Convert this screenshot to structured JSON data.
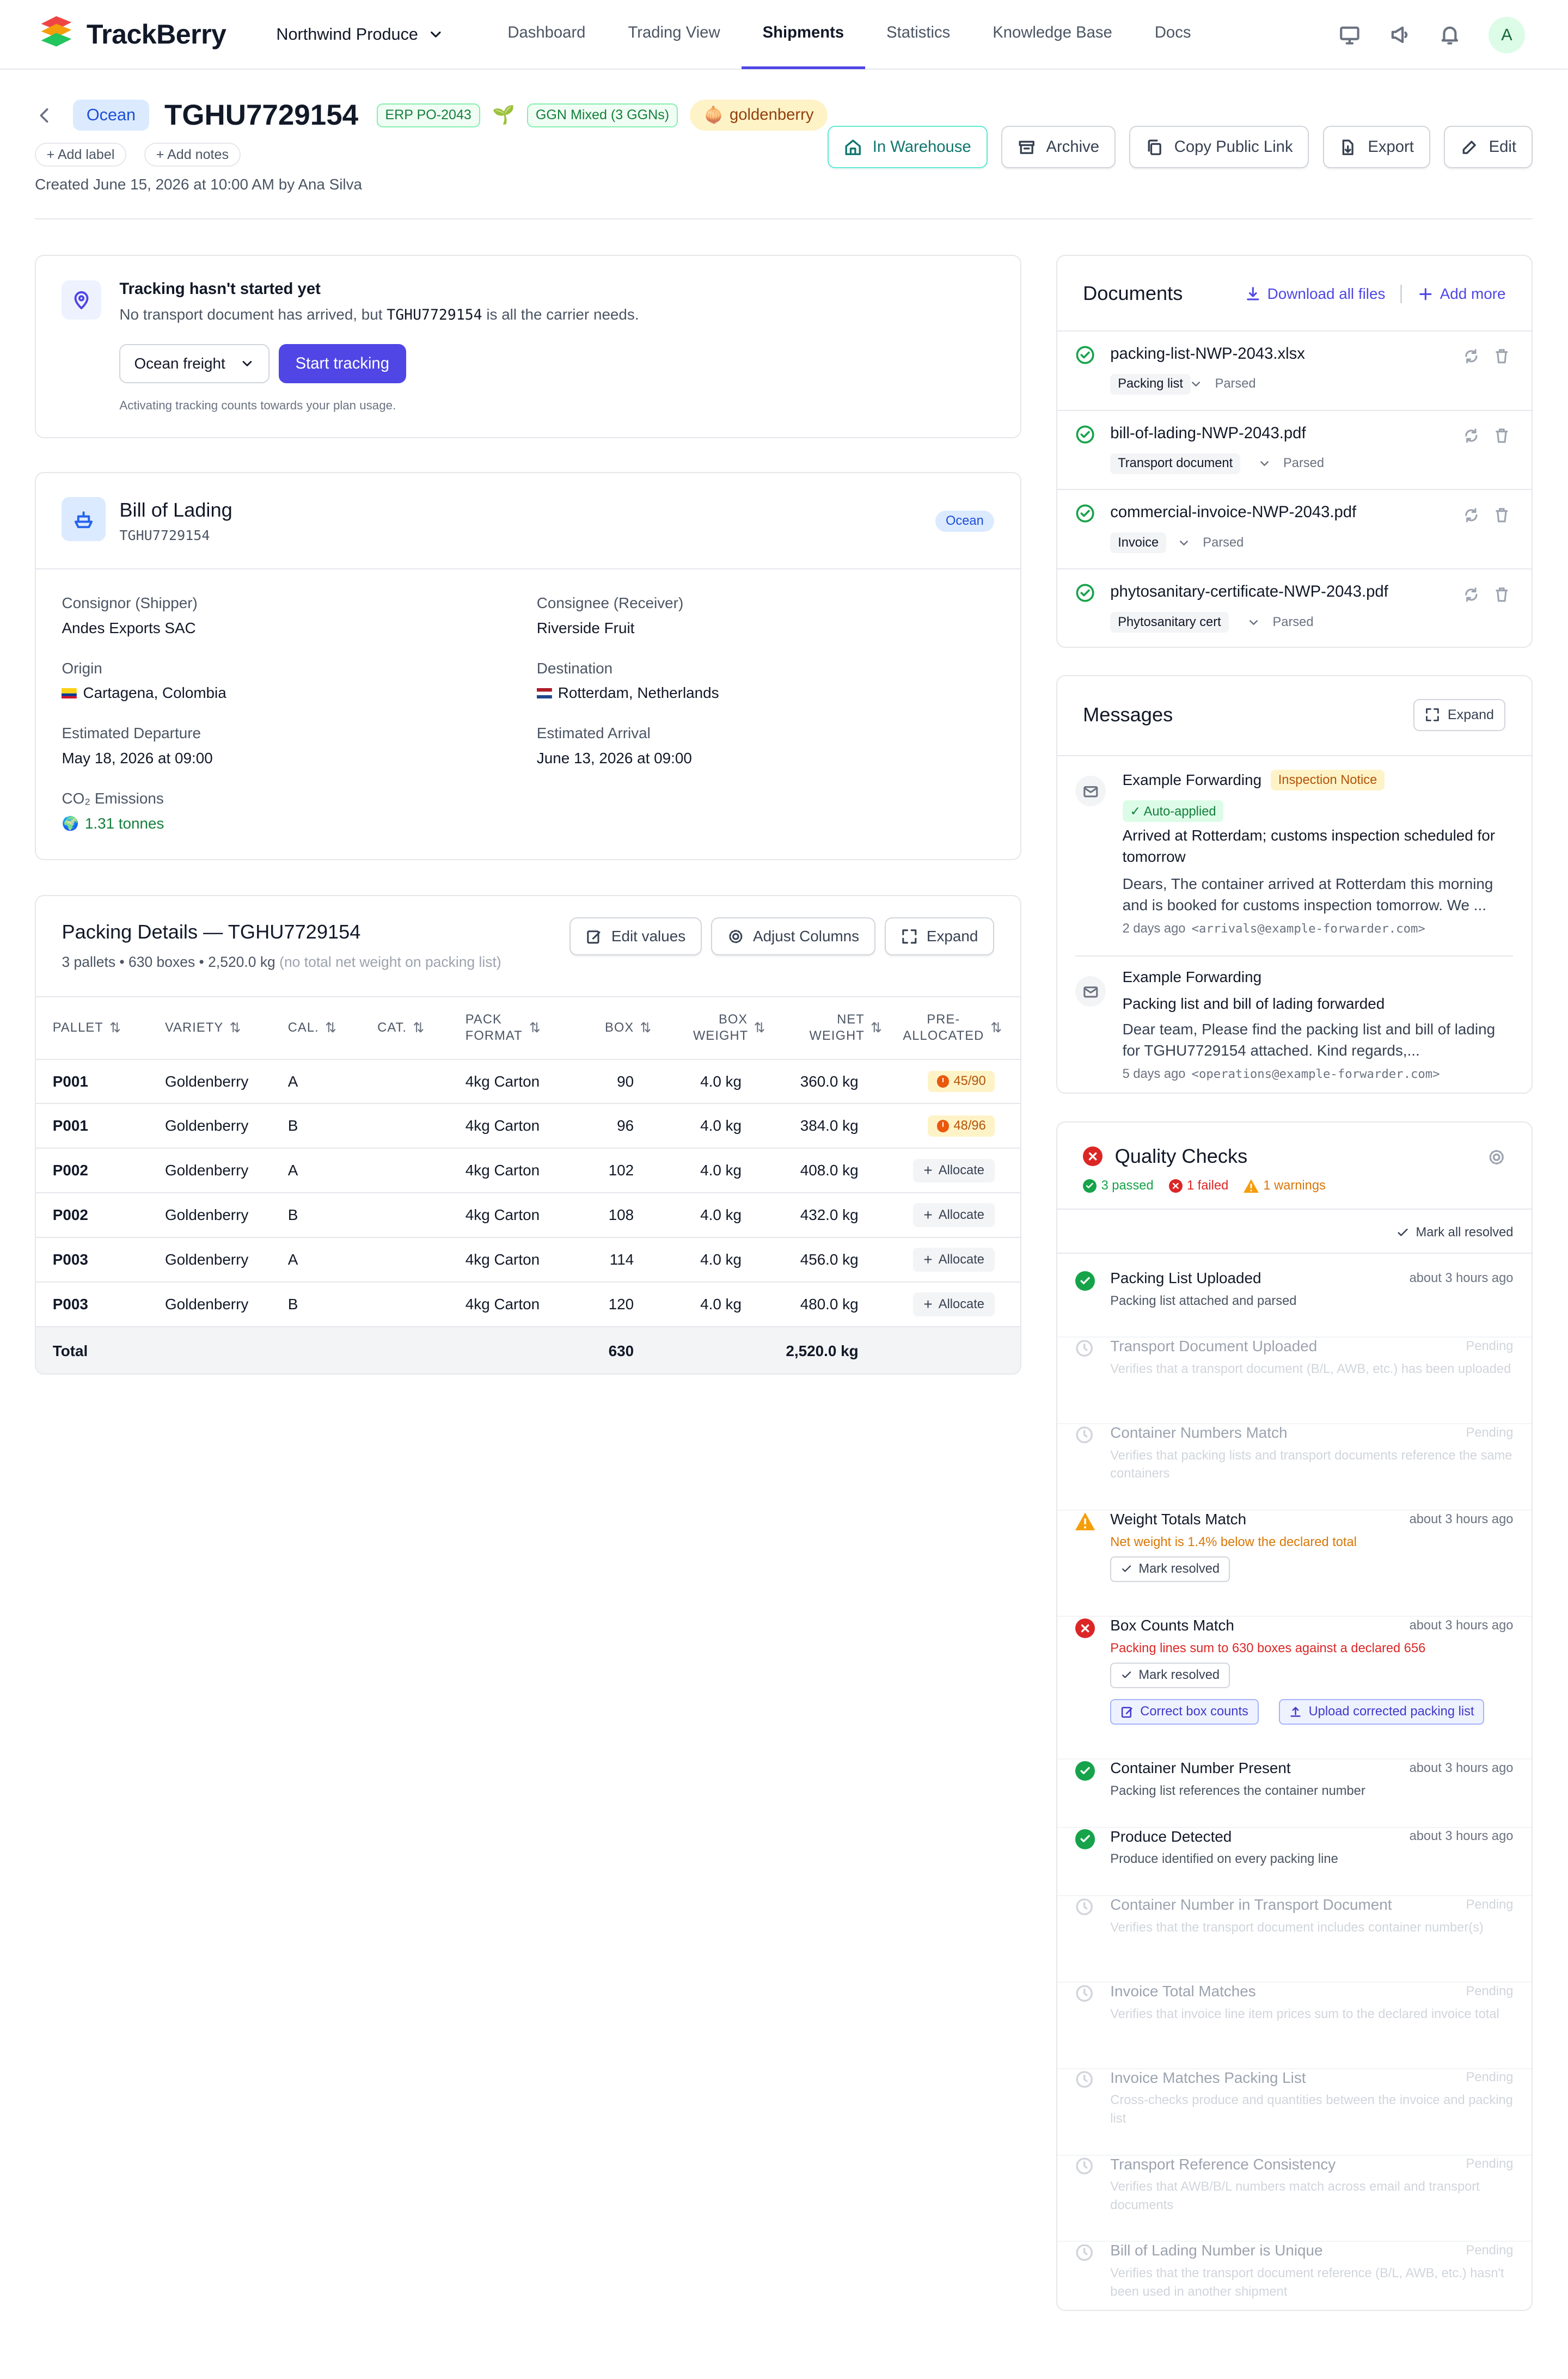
{
  "nav": {
    "brand": "TrackBerry",
    "org": "Northwind Produce",
    "links": [
      "Dashboard",
      "Trading View",
      "Shipments",
      "Statistics",
      "Knowledge Base",
      "Docs"
    ],
    "active": "Shipments",
    "avatar": "A"
  },
  "header": {
    "mode": "Ocean",
    "title": "TGHU7729154",
    "erp": "ERP PO-2043",
    "ggn": "GGN Mixed (3 GGNs)",
    "product": "goldenberry",
    "add_label": "Add label",
    "add_notes": "Add notes",
    "created": "Created June 15, 2026 at 10:00 AM by Ana Silva",
    "actions": {
      "status": "In Warehouse",
      "archive": "Archive",
      "copy_link": "Copy Public Link",
      "export": "Export",
      "edit": "Edit"
    }
  },
  "tracking": {
    "title": "Tracking hasn't started yet",
    "sub_pre": "No transport document has arrived, but",
    "sub_code": "TGHU7729154",
    "sub_post": "is all the carrier needs.",
    "select": "Ocean freight",
    "start": "Start tracking",
    "footnote": "Activating tracking counts towards your plan usage."
  },
  "bol": {
    "title": "Bill of Lading",
    "number": "TGHU7729154",
    "badge": "Ocean",
    "consignor_label": "Consignor (Shipper)",
    "consignor": "Andes Exports SAC",
    "consignee_label": "Consignee (Receiver)",
    "consignee": "Riverside Fruit",
    "origin_label": "Origin",
    "origin": "Cartagena, Colombia",
    "destination_label": "Destination",
    "destination": "Rotterdam, Netherlands",
    "etd_label": "Estimated Departure",
    "etd": "May 18, 2026 at 09:00",
    "eta_label": "Estimated Arrival",
    "eta": "June 13, 2026 at 09:00",
    "co2_label": "CO₂ Emissions",
    "co2": "1.31 tonnes"
  },
  "packing": {
    "title": "Packing Details — TGHU7729154",
    "summary": "3 pallets • 630 boxes • 2,520.0 kg",
    "summary_note": "(no total net weight on packing list)",
    "edit_values": "Edit values",
    "adjust_columns": "Adjust Columns",
    "expand": "Expand",
    "columns": [
      "PALLET",
      "VARIETY",
      "CAL.",
      "CAT.",
      "PACK FORMAT",
      "BOX",
      "BOX WEIGHT",
      "NET WEIGHT",
      "PRE-ALLOCATED"
    ],
    "rows": [
      {
        "pallet": "P001",
        "variety": "Goldenberry",
        "cal": "A",
        "cat": "",
        "format": "4kg Carton",
        "box": "90",
        "box_weight": "4.0 kg",
        "net": "360.0 kg",
        "pre": "45/90",
        "pre_type": "warn"
      },
      {
        "pallet": "P001",
        "variety": "Goldenberry",
        "cal": "B",
        "cat": "",
        "format": "4kg Carton",
        "box": "96",
        "box_weight": "4.0 kg",
        "net": "384.0 kg",
        "pre": "48/96",
        "pre_type": "warn"
      },
      {
        "pallet": "P002",
        "variety": "Goldenberry",
        "cal": "A",
        "cat": "",
        "format": "4kg Carton",
        "box": "102",
        "box_weight": "4.0 kg",
        "net": "408.0 kg",
        "pre": "Allocate",
        "pre_type": "alloc"
      },
      {
        "pallet": "P002",
        "variety": "Goldenberry",
        "cal": "B",
        "cat": "",
        "format": "4kg Carton",
        "box": "108",
        "box_weight": "4.0 kg",
        "net": "432.0 kg",
        "pre": "Allocate",
        "pre_type": "alloc"
      },
      {
        "pallet": "P003",
        "variety": "Goldenberry",
        "cal": "A",
        "cat": "",
        "format": "4kg Carton",
        "box": "114",
        "box_weight": "4.0 kg",
        "net": "456.0 kg",
        "pre": "Allocate",
        "pre_type": "alloc"
      },
      {
        "pallet": "P003",
        "variety": "Goldenberry",
        "cal": "B",
        "cat": "",
        "format": "4kg Carton",
        "box": "120",
        "box_weight": "4.0 kg",
        "net": "480.0 kg",
        "pre": "Allocate",
        "pre_type": "alloc"
      }
    ],
    "total_label": "Total",
    "total_box": "630",
    "total_net": "2,520.0 kg"
  },
  "documents": {
    "title": "Documents",
    "download_all": "Download all files",
    "add_more": "Add more",
    "items": [
      {
        "name": "packing-list-NWP-2043.xlsx",
        "type": "Packing list",
        "status": "Parsed"
      },
      {
        "name": "bill-of-lading-NWP-2043.pdf",
        "type": "Transport document",
        "status": "Parsed"
      },
      {
        "name": "commercial-invoice-NWP-2043.pdf",
        "type": "Invoice",
        "status": "Parsed"
      },
      {
        "name": "phytosanitary-certificate-NWP-2043.pdf",
        "type": "Phytosanitary cert",
        "status": "Parsed"
      }
    ]
  },
  "messages": {
    "title": "Messages",
    "expand": "Expand",
    "items": [
      {
        "from": "Example Forwarding",
        "tag": "Inspection Notice",
        "auto": "✓ Auto-applied",
        "subject": "Arrived at Rotterdam; customs inspection scheduled for tomorrow",
        "body": "Dears, The container arrived at Rotterdam this morning and is booked for customs inspection tomorrow. We ...",
        "ago": "2 days ago",
        "email": "<arrivals@example-forwarder.com>"
      },
      {
        "from": "Example Forwarding",
        "subject": "Packing list and bill of lading forwarded",
        "body": "Dear team, Please find the packing list and bill of lading for TGHU7729154 attached. Kind regards,...",
        "ago": "5 days ago",
        "email": "<operations@example-forwarder.com>"
      }
    ]
  },
  "quality": {
    "title": "Quality Checks",
    "passed": "3 passed",
    "failed": "1 failed",
    "warnings": "1 warnings",
    "mark_all": "Mark all resolved",
    "mark_resolved": "Mark resolved",
    "correct_boxes": "Correct box counts",
    "upload_corrected": "Upload corrected packing list",
    "checks": [
      {
        "name": "Packing List Uploaded",
        "desc": "Packing list attached and parsed",
        "time": "about 3 hours ago",
        "status": "pass"
      },
      {
        "name": "Transport Document Uploaded",
        "desc": "Verifies that a transport document (B/L, AWB, etc.) has been uploaded",
        "time": "Pending",
        "status": "pending"
      },
      {
        "name": "Container Numbers Match",
        "desc": "Verifies that packing lists and transport documents reference the same containers",
        "time": "Pending",
        "status": "pending"
      },
      {
        "name": "Weight Totals Match",
        "desc": "Net weight is 1.4% below the declared total",
        "time": "about 3 hours ago",
        "status": "warn"
      },
      {
        "name": "Box Counts Match",
        "desc": "Packing lines sum to 630 boxes against a declared 656",
        "time": "about 3 hours ago",
        "status": "fail"
      },
      {
        "name": "Container Number Present",
        "desc": "Packing list references the container number",
        "time": "about 3 hours ago",
        "status": "pass"
      },
      {
        "name": "Produce Detected",
        "desc": "Produce identified on every packing line",
        "time": "about 3 hours ago",
        "status": "pass"
      },
      {
        "name": "Container Number in Transport Document",
        "desc": "Verifies that the transport document includes container number(s)",
        "time": "Pending",
        "status": "pending"
      },
      {
        "name": "Invoice Total Matches",
        "desc": "Verifies that invoice line item prices sum to the declared invoice total",
        "time": "Pending",
        "status": "pending"
      },
      {
        "name": "Invoice Matches Packing List",
        "desc": "Cross-checks produce and quantities between the invoice and packing list",
        "time": "Pending",
        "status": "pending"
      },
      {
        "name": "Transport Reference Consistency",
        "desc": "Verifies that AWB/B/L numbers match across email and transport documents",
        "time": "Pending",
        "status": "pending"
      },
      {
        "name": "Bill of Lading Number is Unique",
        "desc": "Verifies that the transport document reference (B/L, AWB, etc.) hasn't been used in another shipment",
        "time": "Pending",
        "status": "pending"
      }
    ]
  },
  "colors": {
    "accent": "#4f46e5",
    "success": "#16a34a",
    "danger": "#dc2626",
    "warning": "#d97706"
  }
}
